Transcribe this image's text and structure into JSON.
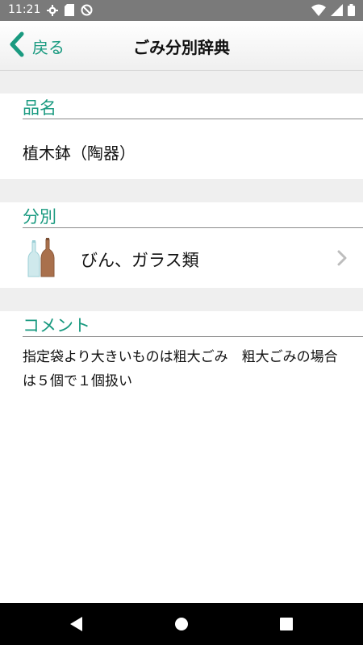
{
  "status_bar": {
    "time": "11:21",
    "left_icons": [
      "settings-icon",
      "sd-card-icon",
      "data-saver-icon"
    ],
    "right_icons": [
      "wifi-icon",
      "signal-icon",
      "battery-icon"
    ]
  },
  "header": {
    "back_label": "戻る",
    "title": "ごみ分別辞典"
  },
  "item_section": {
    "heading": "品名",
    "value": "植木鉢（陶器）"
  },
  "category_section": {
    "heading": "分別",
    "value": "びん、ガラス類",
    "icon": "bottles-icon"
  },
  "comment_section": {
    "heading": "コメント",
    "text": "指定袋より大きいものは粗大ごみ　粗大ごみの場合は５個で１個扱い"
  },
  "system_nav": {
    "buttons": [
      "back-triangle",
      "home-circle",
      "recents-square"
    ]
  },
  "colors": {
    "accent": "#1a9a80",
    "status_bar": "#7a7a7a",
    "section_gap": "#efefef",
    "system_nav": "#000000"
  }
}
